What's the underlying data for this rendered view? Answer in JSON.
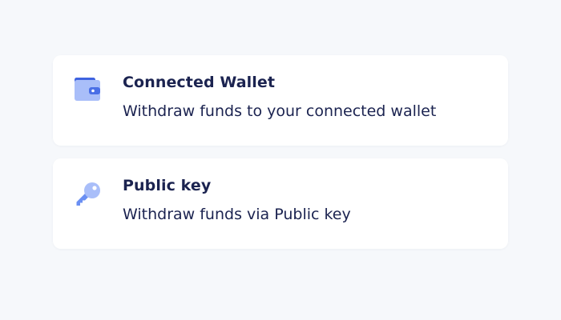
{
  "accent_color": "#6a8ff3",
  "options": [
    {
      "icon": "wallet-icon",
      "title": "Connected Wallet",
      "description": "Withdraw funds to your connected wallet"
    },
    {
      "icon": "key-icon",
      "title": "Public key",
      "description": "Withdraw funds via Public key"
    }
  ]
}
